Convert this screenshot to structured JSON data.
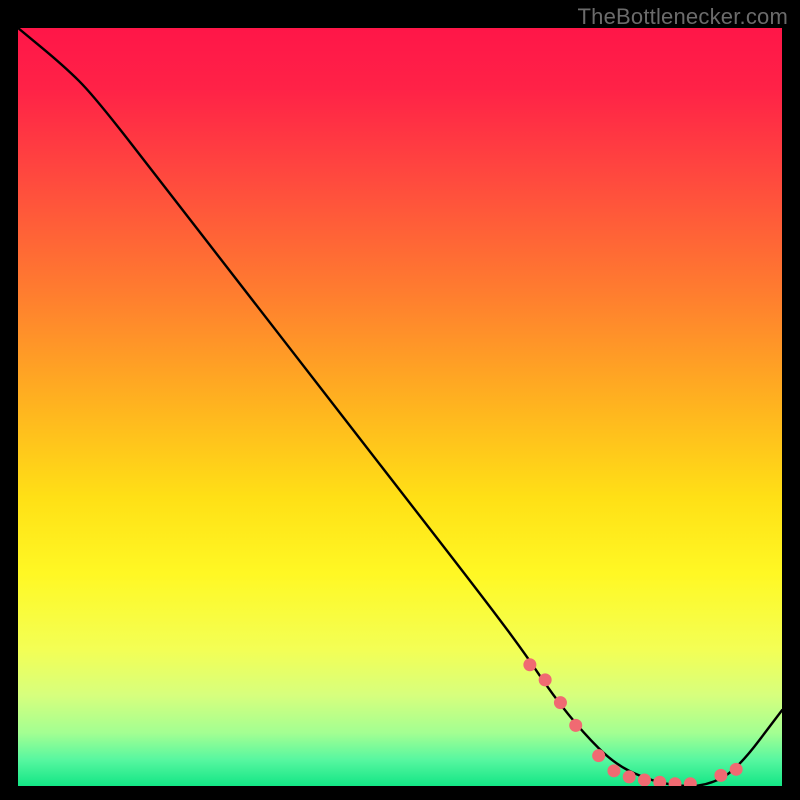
{
  "watermark": "TheBottlenecker.com",
  "chart_data": {
    "type": "line",
    "title": "",
    "xlabel": "",
    "ylabel": "",
    "xlim": [
      0,
      100
    ],
    "ylim": [
      0,
      100
    ],
    "grid": false,
    "series": [
      {
        "name": "curve",
        "x": [
          0,
          6,
          10,
          20,
          30,
          40,
          50,
          60,
          66,
          70,
          74,
          78,
          82,
          86,
          90,
          94,
          100
        ],
        "y": [
          100,
          95,
          91,
          78,
          65,
          52,
          39,
          26,
          18,
          12,
          7,
          3,
          1,
          0,
          0,
          2,
          10
        ]
      }
    ],
    "markers": {
      "name": "highlight-dots",
      "color": "#f06a72",
      "x": [
        67,
        69,
        71,
        73,
        76,
        78,
        80,
        82,
        84,
        86,
        88,
        92,
        94
      ],
      "y": [
        16,
        14,
        11,
        8,
        4,
        2,
        1.2,
        0.8,
        0.5,
        0.3,
        0.3,
        1.4,
        2.2
      ]
    },
    "gradient_stops": [
      {
        "offset": 0.0,
        "color": "#ff1648"
      },
      {
        "offset": 0.08,
        "color": "#ff2247"
      },
      {
        "offset": 0.2,
        "color": "#ff4a3e"
      },
      {
        "offset": 0.35,
        "color": "#ff7d2f"
      },
      {
        "offset": 0.5,
        "color": "#ffb41f"
      },
      {
        "offset": 0.62,
        "color": "#ffe016"
      },
      {
        "offset": 0.72,
        "color": "#fff824"
      },
      {
        "offset": 0.82,
        "color": "#f3ff55"
      },
      {
        "offset": 0.88,
        "color": "#d7ff7d"
      },
      {
        "offset": 0.93,
        "color": "#a3ff92"
      },
      {
        "offset": 0.965,
        "color": "#58f7a0"
      },
      {
        "offset": 1.0,
        "color": "#13e686"
      }
    ]
  }
}
